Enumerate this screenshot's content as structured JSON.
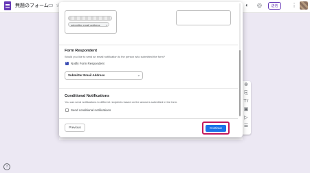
{
  "app": {
    "doc_title": "無題のフォーム",
    "send_label": "送信",
    "icons": [
      "form-logo-icon",
      "folder-icon",
      "star-icon",
      "palette-icon",
      "preview-icon",
      "more-icon",
      "help-icon"
    ]
  },
  "dialog": {
    "recipient_chip": "submitter email address",
    "form_respondent": {
      "title": "Form Respondent",
      "description": "Would you like to send an email notification to the person who submitted the form?",
      "checkbox_label": "Notify Form Respondent",
      "checked": true,
      "select_value": "Submitter Email Address"
    },
    "conditional": {
      "title": "Conditional Notifications",
      "description": "You can send notifications to different recipients based on the answers submitted in the form.",
      "checkbox_label": "Send conditional notifications",
      "checked": false
    },
    "buttons": {
      "previous": "Previous",
      "continue": "Continue"
    }
  },
  "side_toolbar": [
    "add-question-icon",
    "import-icon",
    "title-icon",
    "image-icon",
    "video-icon",
    "section-icon"
  ],
  "colors": {
    "accent": "#673ab7",
    "primary_button": "#1a73e8",
    "highlight": "#c2185b",
    "background": "#ece8f3"
  }
}
